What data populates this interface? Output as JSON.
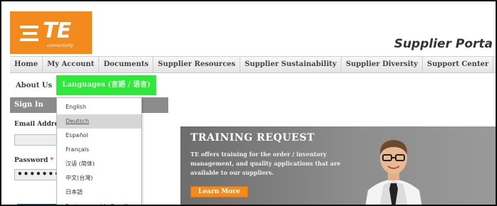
{
  "brand": {
    "logo_text": "TE",
    "logo_subtext": "connectivity",
    "portal_title": "Supplier Porta",
    "accent_color": "#f28a1e"
  },
  "nav": {
    "items": [
      {
        "label": "Home"
      },
      {
        "label": "My Account"
      },
      {
        "label": "Documents"
      },
      {
        "label": "Supplier Resources"
      },
      {
        "label": "Supplier Sustainability"
      },
      {
        "label": "Supplier Diversity"
      },
      {
        "label": "Support Center"
      }
    ]
  },
  "subnav": {
    "about": "About Us",
    "languages": "Languages (言語 / 语言)",
    "highlight_color": "#2ee83a"
  },
  "signin": {
    "title": "Sign In",
    "email_label": "Email Addre",
    "password_label": "Password",
    "required_mark": "*",
    "password_mask": "••••••••"
  },
  "languages": {
    "items": [
      {
        "label": "English"
      },
      {
        "label": "Deutsch"
      },
      {
        "label": "Español"
      },
      {
        "label": "Français"
      },
      {
        "label": "汉语 (简体)"
      },
      {
        "label": "中文(台灣)"
      },
      {
        "label": "日本語"
      },
      {
        "label": "Portuguese (do Brazil)"
      }
    ],
    "hovered_item": "Deutsch"
  },
  "banner": {
    "title": "TRAINING REQUEST",
    "text": "TE offers training for the order / inventory management, and quality applications that are available to our suppliers.",
    "button_label": "Learn More"
  }
}
